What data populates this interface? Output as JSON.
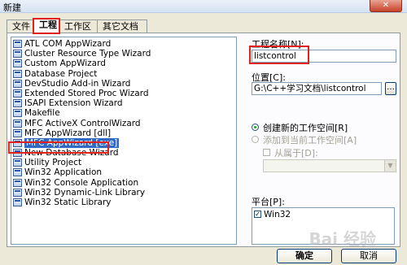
{
  "window": {
    "title": "新建",
    "close_label": "✕"
  },
  "tabs": [
    {
      "label": "文件"
    },
    {
      "label": "工程"
    },
    {
      "label": "工作区"
    },
    {
      "label": "其它文档"
    }
  ],
  "project_types": [
    "ATL COM AppWizard",
    "Cluster Resource Type Wizard",
    "Custom AppWizard",
    "Database Project",
    "DevStudio Add-in Wizard",
    "Extended Stored Proc Wizard",
    "ISAPI Extension Wizard",
    "Makefile",
    "MFC ActiveX ControlWizard",
    "MFC AppWizard [dll]",
    "MFC AppWizard [exe]",
    "New Database Wizard",
    "Utility Project",
    "Win32 Application",
    "Win32 Console Application",
    "Win32 Dynamic-Link Library",
    "Win32 Static Library"
  ],
  "selected_project_type": "MFC AppWizard [exe]",
  "project_name": {
    "label": "工程名称[N]:",
    "value": "listcontrol"
  },
  "location": {
    "label": "位置[C]:",
    "value": "G:\\C++学习文档\\listcontrol",
    "browse_label": "..."
  },
  "workspace": {
    "create_new": "创建新的工作空间[R]",
    "add_to_current": "添加到当前工作空间[A]",
    "dependency": "从属于[D]:"
  },
  "platform": {
    "label": "平台[P]:",
    "item": "Win32",
    "check_mark": "✓"
  },
  "buttons": {
    "ok": "确定",
    "cancel": "取消"
  },
  "watermark": "Bai 经验",
  "colors": {
    "highlight_box": "#e0211d",
    "selection": "#316ac5"
  }
}
